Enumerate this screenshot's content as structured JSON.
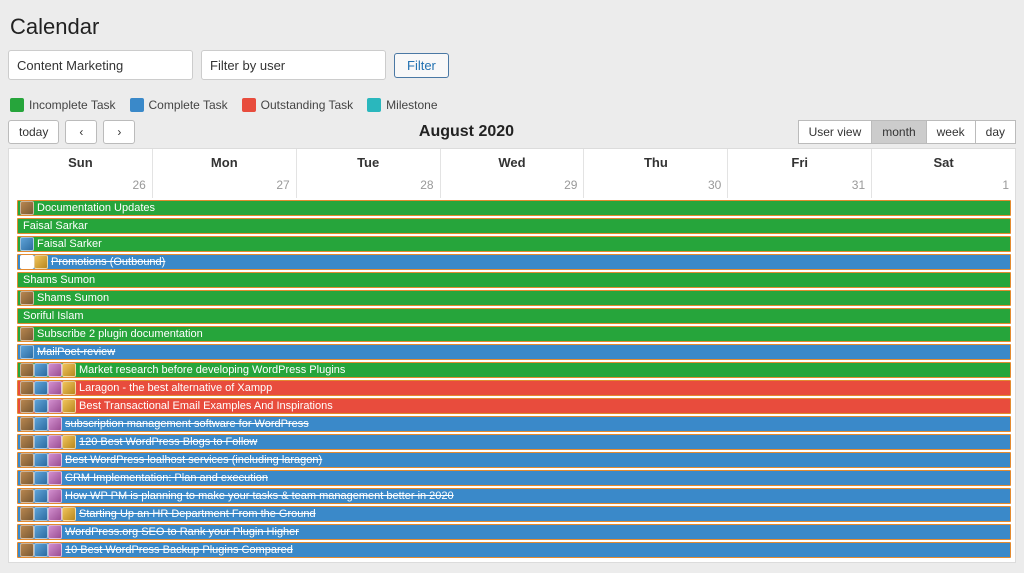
{
  "page": {
    "title": "Calendar"
  },
  "filters": {
    "category": "Content Marketing",
    "user_placeholder": "Filter by user",
    "filter_btn": "Filter"
  },
  "legend": {
    "items": [
      {
        "label": "Incomplete Task",
        "color": "#26a53b"
      },
      {
        "label": "Complete Task",
        "color": "#3a89c9"
      },
      {
        "label": "Outstanding Task",
        "color": "#e84c3d"
      },
      {
        "label": "Milestone",
        "color": "#2ab7bd"
      }
    ]
  },
  "toolbar": {
    "today": "today",
    "prev": "‹",
    "next": "›",
    "period": "August 2020",
    "views": {
      "user": "User view",
      "month": "month",
      "week": "week",
      "day": "day"
    }
  },
  "calendar": {
    "days": [
      "Sun",
      "Mon",
      "Tue",
      "Wed",
      "Thu",
      "Fri",
      "Sat"
    ],
    "dates": [
      "26",
      "27",
      "28",
      "29",
      "30",
      "31",
      "1"
    ]
  },
  "tasks": [
    {
      "label": "Documentation Updates",
      "color": "green",
      "strike": false,
      "avatars": [
        "a1"
      ]
    },
    {
      "label": "Faisal Sarkar",
      "color": "green",
      "strike": false,
      "avatars": []
    },
    {
      "label": "Faisal Sarker",
      "color": "green",
      "strike": false,
      "avatars": [
        "a2"
      ]
    },
    {
      "label": "Promotions (Outbound)",
      "color": "blue",
      "strike": true,
      "avatars": [
        "w",
        "a4"
      ]
    },
    {
      "label": "Shams Sumon",
      "color": "green",
      "strike": false,
      "avatars": []
    },
    {
      "label": "Shams Sumon",
      "color": "green",
      "strike": false,
      "avatars": [
        "a1"
      ]
    },
    {
      "label": "Soriful Islam",
      "color": "green",
      "strike": false,
      "avatars": []
    },
    {
      "label": "Subscribe 2 plugin documentation",
      "color": "green",
      "strike": false,
      "avatars": [
        "a1"
      ]
    },
    {
      "label": "MailPoet-review",
      "color": "blue",
      "strike": true,
      "avatars": [
        "a2"
      ]
    },
    {
      "label": "Market research before developing WordPress Plugins",
      "color": "green",
      "strike": false,
      "avatars": [
        "a1",
        "a2",
        "a3",
        "a4"
      ]
    },
    {
      "label": "Laragon - the best alternative of Xampp",
      "color": "red",
      "strike": false,
      "avatars": [
        "a1",
        "a2",
        "a3",
        "a4"
      ]
    },
    {
      "label": "Best Transactional Email Examples And Inspirations",
      "color": "red",
      "strike": false,
      "avatars": [
        "a1",
        "a2",
        "a3",
        "a4"
      ]
    },
    {
      "label": "subscription management software for WordPress",
      "color": "blue",
      "strike": true,
      "avatars": [
        "a1",
        "a2",
        "a3"
      ]
    },
    {
      "label": "120 Best WordPress Blogs to Follow",
      "color": "blue",
      "strike": true,
      "avatars": [
        "a1",
        "a2",
        "a3",
        "a4"
      ]
    },
    {
      "label": "Best WordPress loalhost services (including laragon)",
      "color": "blue",
      "strike": true,
      "avatars": [
        "a1",
        "a2",
        "a3"
      ]
    },
    {
      "label": "CRM Implementation: Plan and execution",
      "color": "blue",
      "strike": true,
      "avatars": [
        "a1",
        "a2",
        "a3"
      ]
    },
    {
      "label": "How WP PM is planning to make your tasks & team management better in 2020",
      "color": "blue",
      "strike": true,
      "avatars": [
        "a1",
        "a2",
        "a3"
      ]
    },
    {
      "label": "Starting Up an HR Department From the Ground",
      "color": "blue",
      "strike": true,
      "avatars": [
        "a1",
        "a2",
        "a3",
        "a4"
      ]
    },
    {
      "label": "WordPress.org SEO to Rank your Plugin Higher",
      "color": "blue",
      "strike": true,
      "avatars": [
        "a1",
        "a2",
        "a3"
      ]
    },
    {
      "label": "10 Best WordPress Backup Plugins Compared",
      "color": "blue",
      "strike": true,
      "avatars": [
        "a1",
        "a2",
        "a3"
      ]
    }
  ]
}
